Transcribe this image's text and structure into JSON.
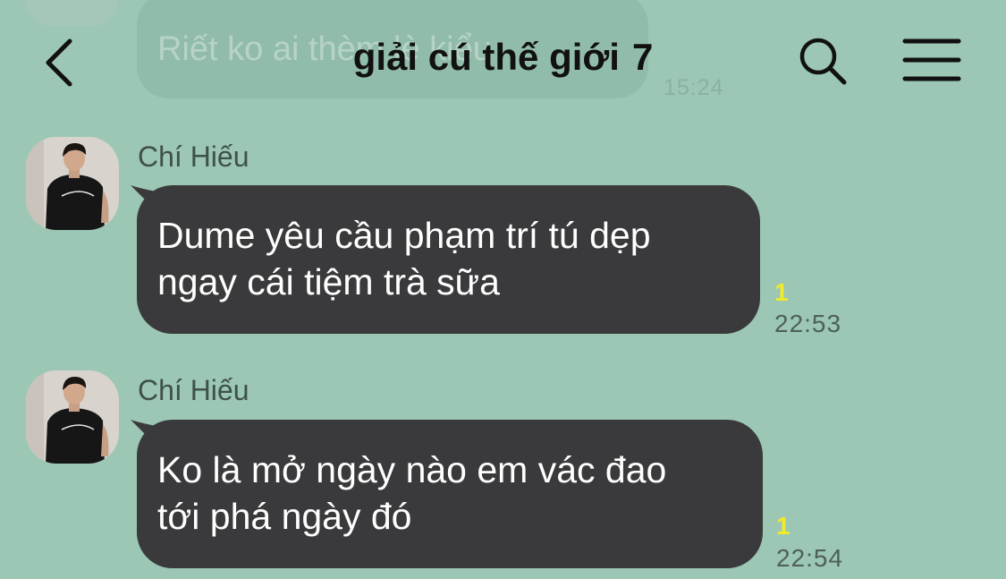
{
  "header": {
    "title": "giải cú thế giới",
    "member_count": "7",
    "back_icon": "chevron-left",
    "search_icon": "magnifier",
    "menu_icon": "hamburger"
  },
  "background_message": {
    "text": "Riết ko ai thèm lè kiểu",
    "time": "15:24"
  },
  "messages": [
    {
      "sender": "Chí Hiếu",
      "line1": "Dume yêu cầu phạm trí tú dẹp",
      "line2": "ngay cái tiệm trà sữa",
      "read_count": "1",
      "time": "22:53"
    },
    {
      "sender": "Chí Hiếu",
      "line1": "Ko là mở ngày nào em vác đao",
      "line2": "tới phá ngày đó",
      "read_count": "1",
      "time": "22:54"
    }
  ],
  "colors": {
    "background": "#9bc7b4",
    "bubble": "#3a3a3c",
    "bubble_text": "#ffffff",
    "read_indicator": "#f2ea2c",
    "sender_name": "#3f5149"
  }
}
